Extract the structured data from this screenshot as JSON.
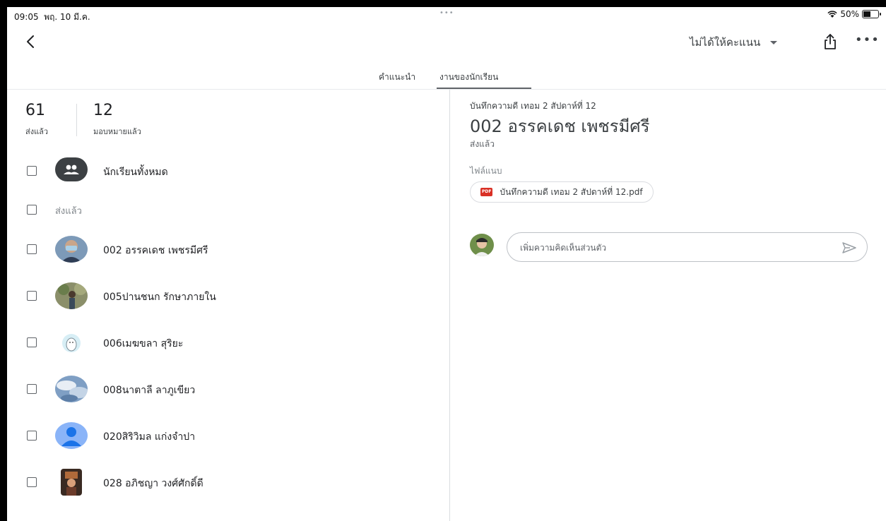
{
  "status": {
    "time": "09:05",
    "date": "พฤ. 10 มี.ค.",
    "dots": "•••",
    "battery": "50%"
  },
  "toolbar": {
    "grade_label": "ไม่ได้ให้คะแนน",
    "more": "•••"
  },
  "tabs": [
    {
      "label": "คำแนะนำ"
    },
    {
      "label": "งานของนักเรียน"
    }
  ],
  "counts": {
    "handed_in": {
      "value": "61",
      "label": "ส่งแล้ว"
    },
    "assigned": {
      "value": "12",
      "label": "มอบหมายแล้ว"
    }
  },
  "all_students": {
    "label": "นักเรียนทั้งหมด"
  },
  "section": {
    "label": "ส่งแล้ว"
  },
  "students": [
    {
      "name": "002 อรรคเดช เพชรมีศรี"
    },
    {
      "name": "005ปานชนก รักษาภายใน"
    },
    {
      "name": "006เมฆขลา สุริยะ"
    },
    {
      "name": "008นาตาลี ลาภูเขียว"
    },
    {
      "name": "020สิริวิมล แก่งจำปา"
    },
    {
      "name": "028 อภิชญา วงศ์ศักดิ์ดี"
    }
  ],
  "detail": {
    "assignment_title": "บันทึกความดี เทอม 2 สัปดาห์ที่ 12",
    "student_name": "002 อรรคเดช เพชรมีศรี",
    "status": "ส่งแล้ว",
    "attachments_label": "ไฟล์แนบ",
    "attachment_name": "บันทึกความดี เทอม 2 สัปดาห์ที่ 12.pdf",
    "pdf_badge": "PDF",
    "comment_placeholder": "เพิ่มความคิดเห็นส่วนตัว"
  }
}
